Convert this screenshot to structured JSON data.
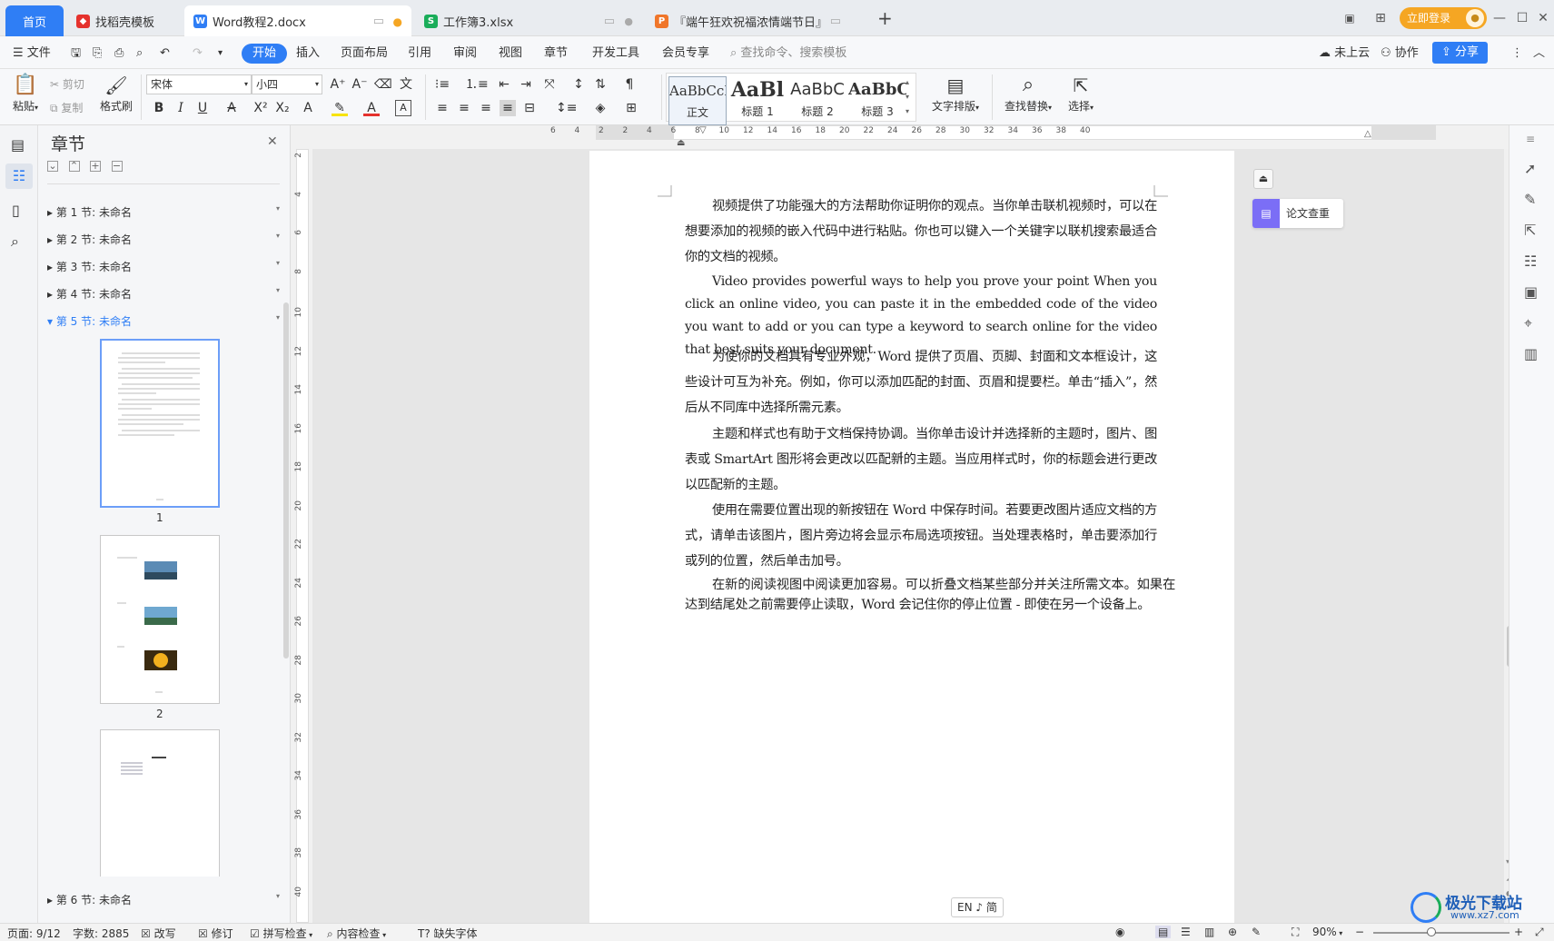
{
  "tabs": {
    "home": "首页",
    "t1": "找稻壳模板",
    "t2": "Word教程2.docx",
    "t3": "工作簿3.xlsx",
    "t4": "『端午狂欢祝福浓情端节日』",
    "new_tab": "+",
    "login_btn": "立即登录"
  },
  "menu": {
    "file": "文件",
    "start": "开始",
    "insert": "插入",
    "layout": "页面布局",
    "ref": "引用",
    "review": "审阅",
    "view": "视图",
    "chapter": "章节",
    "dev": "开发工具",
    "member": "会员专享",
    "search": "查找命令、搜索模板",
    "cloud": "未上云",
    "collab": "协作",
    "share": "分享"
  },
  "ribbon": {
    "paste": "粘贴",
    "cut": "剪切",
    "copy": "复制",
    "format_painter": "格式刷",
    "font": "宋体",
    "size": "小四",
    "styles": [
      {
        "preview": "AaBbCcI",
        "name": "正文"
      },
      {
        "preview": "AaBl",
        "name": "标题 1"
      },
      {
        "preview": "AaBbC",
        "name": "标题 2"
      },
      {
        "preview": "AaBbC",
        "name": "标题 3"
      }
    ],
    "text_layout": "文字排版",
    "find_replace": "查找替换",
    "select": "选择"
  },
  "nav": {
    "title": "章节",
    "sections": [
      "第 1 节: 未命名",
      "第 2 节: 未命名",
      "第 3 节: 未命名",
      "第 4 节: 未命名",
      "第 5 节: 未命名",
      "第 6 节: 未命名"
    ],
    "thumb1_label": "1",
    "thumb2_label": "2"
  },
  "ruler": {
    "h_ticks": [
      "6",
      "4",
      "2",
      "2",
      "4",
      "6",
      "8",
      "10",
      "12",
      "14",
      "16",
      "18",
      "20",
      "22",
      "24",
      "26",
      "28",
      "30",
      "32",
      "34",
      "36",
      "38",
      "40"
    ],
    "v_ticks": [
      "2",
      "4",
      "6",
      "8",
      "10",
      "12",
      "14",
      "16",
      "18",
      "20",
      "22",
      "24",
      "26",
      "28",
      "30",
      "32",
      "34",
      "36",
      "38",
      "40"
    ]
  },
  "document": {
    "paragraphs": [
      "视频提供了功能强大的方法帮助你证明你的观点。当你单击联机视频时，可以在想要添加的视频的嵌入代码中进行粘贴。你也可以键入一个关键字以联机搜索最适合你的文档的视频。",
      "Video provides powerful ways to help you prove your point When you click an online video, you can paste it in the embedded code of the video you want to add or you can type a keyword to search online for the video that best suits your document.",
      "为使你的文档具有专业外观，Word 提供了页眉、页脚、封面和文本框设计，这些设计可互为补充。例如，你可以添加匹配的封面、页眉和提要栏。单击“插入”，然后从不同库中选择所需元素。",
      "主题和样式也有助于文档保持协调。当你单击设计并选择新的主题时，图片、图表或 SmartArt 图形将会更改以匹配新的主题。当应用样式时，你的标题会进行更改以匹配新的主题。",
      "使用在需要位置出现的新按钮在 Word 中保存时间。若要更改图片适应文档的方式，请单击该图片，图片旁边将会显示布局选项按钮。当处理表格时，单击要添加行或列的位置，然后单击加号。",
      "在新的阅读视图中阅读更加容易。可以折叠文档某些部分并关注所需文本。如果在达到结尾处之前需要停止读取，Word 会记住你的停止位置 - 即使在另一个设备上。"
    ],
    "paper_check": "论文查重",
    "ime": "EN ♪ 简"
  },
  "status": {
    "page": "页面: 9/12",
    "words": "字数: 2885",
    "rewrite": "改写",
    "revise": "修订",
    "spell": "拼写检查",
    "content": "内容检查",
    "missing_font": "缺失字体",
    "zoom": "90%"
  },
  "watermark": {
    "name": "极光下载站",
    "url": "www.xz7.com"
  }
}
